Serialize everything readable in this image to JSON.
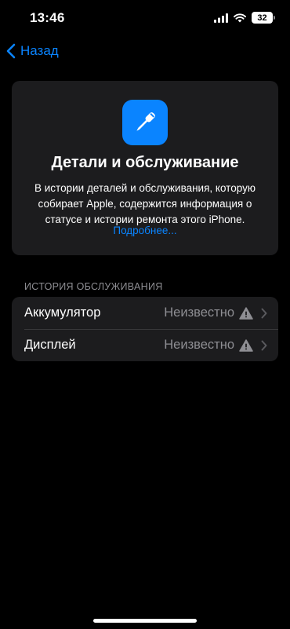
{
  "status_bar": {
    "time": "13:46",
    "battery_level": "32",
    "icons": [
      "signal-icon",
      "wifi-icon",
      "battery-icon"
    ]
  },
  "nav": {
    "back_label": "Назад",
    "back_icon": "chevron-left-icon"
  },
  "info_card": {
    "icon": "screwdriver-icon",
    "title": "Детали и обслуживание",
    "description": "В истории деталей и обслуживания, которую собирает Apple, содержится информация о статусе и истории ремонта этого iPhone.",
    "link": "Подробнее..."
  },
  "service_history": {
    "header": "ИСТОРИЯ ОБСЛУЖИВАНИЯ",
    "rows": [
      {
        "label": "Аккумулятор",
        "value": "Неизвестно",
        "icon": "warning-icon"
      },
      {
        "label": "Дисплей",
        "value": "Неизвестно",
        "icon": "warning-icon"
      }
    ]
  },
  "colors": {
    "background": "#000000",
    "card": "#1c1c1e",
    "accent": "#0a84ff",
    "secondary_text": "#8e8e93"
  }
}
